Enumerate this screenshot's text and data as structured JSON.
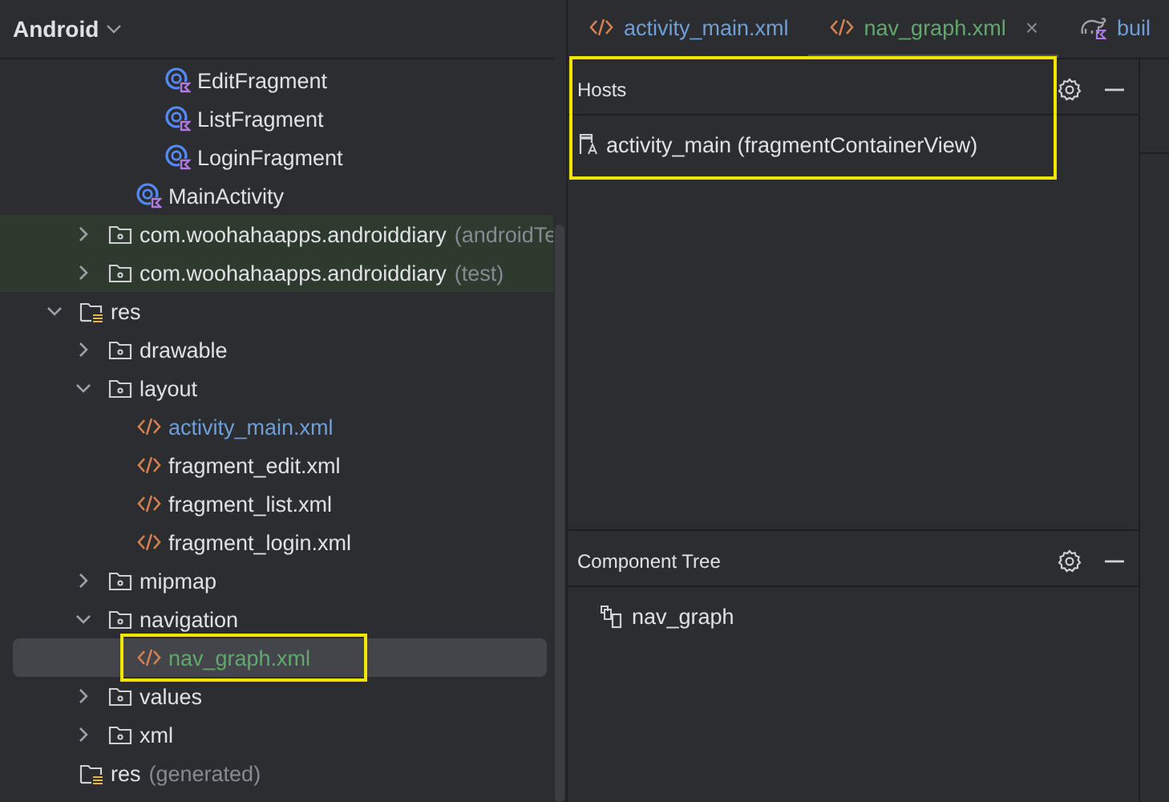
{
  "project_view": {
    "title": "Android",
    "tree": [
      {
        "children": [
          {
            "children": [
              {
                "children": [
                  {
                    "label": "EditFragment",
                    "kind": "class",
                    "selected": false,
                    "highlighted": false,
                    "tinted": false
                  },
                  {
                    "label": "ListFragment",
                    "kind": "class",
                    "selected": false,
                    "highlighted": false,
                    "tinted": false
                  },
                  {
                    "label": "LoginFragment",
                    "kind": "class",
                    "selected": false,
                    "highlighted": false,
                    "tinted": false
                  }
                ]
              },
              {
                "label": "MainActivity",
                "kind": "class",
                "selected": false,
                "highlighted": false,
                "tinted": false
              }
            ]
          },
          {
            "label": "com.woohahaapps.androiddiary",
            "hint": "(androidTe",
            "kind": "folder",
            "expanded": false,
            "selected": false,
            "highlighted": false,
            "tinted": true
          },
          {
            "label": "com.woohahaapps.androiddiary",
            "hint": "(test)",
            "kind": "folder",
            "expanded": false,
            "selected": false,
            "highlighted": false,
            "tinted": true
          }
        ]
      },
      {
        "label": "res",
        "kind": "resroot",
        "expanded": true,
        "selected": false,
        "highlighted": false,
        "tinted": false,
        "children": [
          {
            "label": "drawable",
            "kind": "folder",
            "expanded": false,
            "selected": false,
            "highlighted": false,
            "tinted": false
          },
          {
            "label": "layout",
            "kind": "folder",
            "expanded": true,
            "selected": false,
            "highlighted": false,
            "tinted": false,
            "children": [
              {
                "label": "activity_main.xml",
                "kind": "xml",
                "color": "#6f9fd8",
                "selected": false,
                "highlighted": false,
                "tinted": false
              },
              {
                "label": "fragment_edit.xml",
                "kind": "xml",
                "color": "#dfe1e5",
                "selected": false,
                "highlighted": false,
                "tinted": false
              },
              {
                "label": "fragment_list.xml",
                "kind": "xml",
                "color": "#dfe1e5",
                "selected": false,
                "highlighted": false,
                "tinted": false
              },
              {
                "label": "fragment_login.xml",
                "kind": "xml",
                "color": "#dfe1e5",
                "selected": false,
                "highlighted": false,
                "tinted": false
              }
            ]
          },
          {
            "label": "mipmap",
            "kind": "folder",
            "expanded": false,
            "selected": false,
            "highlighted": false,
            "tinted": false
          },
          {
            "label": "navigation",
            "kind": "folder",
            "expanded": true,
            "selected": false,
            "highlighted": false,
            "tinted": false,
            "children": [
              {
                "label": "nav_graph.xml",
                "kind": "xml",
                "color": "#62a86e",
                "selected": true,
                "highlighted": true,
                "tinted": false
              }
            ]
          },
          {
            "label": "values",
            "kind": "folder",
            "expanded": false,
            "selected": false,
            "highlighted": false,
            "tinted": false
          },
          {
            "label": "xml",
            "kind": "folder",
            "expanded": false,
            "selected": false,
            "highlighted": false,
            "tinted": false
          }
        ]
      },
      {
        "label": "res",
        "hint": "(generated)",
        "kind": "resroot",
        "selected": false,
        "highlighted": false,
        "tinted": false
      }
    ]
  },
  "editor_tabs": [
    {
      "label": "activity_main.xml",
      "kind": "xml",
      "color": "#6f9fd8",
      "selected": false
    },
    {
      "label": "nav_graph.xml",
      "kind": "xml",
      "color": "#62a86e",
      "selected": true,
      "close": "×"
    },
    {
      "label": "buil",
      "kind": "gradle",
      "color": "#6f9fd8",
      "selected": false
    }
  ],
  "hosts": {
    "title": "Hosts",
    "highlighted": true,
    "items": [
      {
        "label": "activity_main (fragmentContainerView)"
      }
    ]
  },
  "component_tree": {
    "title": "Component Tree",
    "items": [
      {
        "label": "nav_graph"
      }
    ]
  }
}
